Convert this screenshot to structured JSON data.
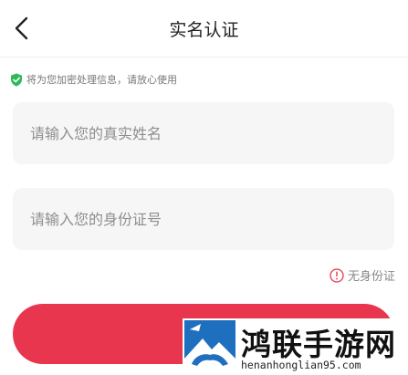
{
  "header": {
    "title": "实名认证",
    "back_icon": "chevron-left-icon"
  },
  "notice": {
    "icon": "shield-check-icon",
    "icon_color": "#2db85c",
    "text": "将为您加密处理信息，请放心使用"
  },
  "form": {
    "name_placeholder": "请输入您的真实姓名",
    "name_value": "",
    "id_placeholder": "请输入您的身份证号",
    "id_value": ""
  },
  "no_id": {
    "icon": "exclamation-circle-icon",
    "icon_color": "#e8364f",
    "label": "无身份证"
  },
  "submit": {
    "label": "",
    "color": "#e8364f"
  },
  "watermark": {
    "title": "鸿联手游网",
    "url": "henanhonglian95.com",
    "logo_color": "#1f6fbf"
  }
}
